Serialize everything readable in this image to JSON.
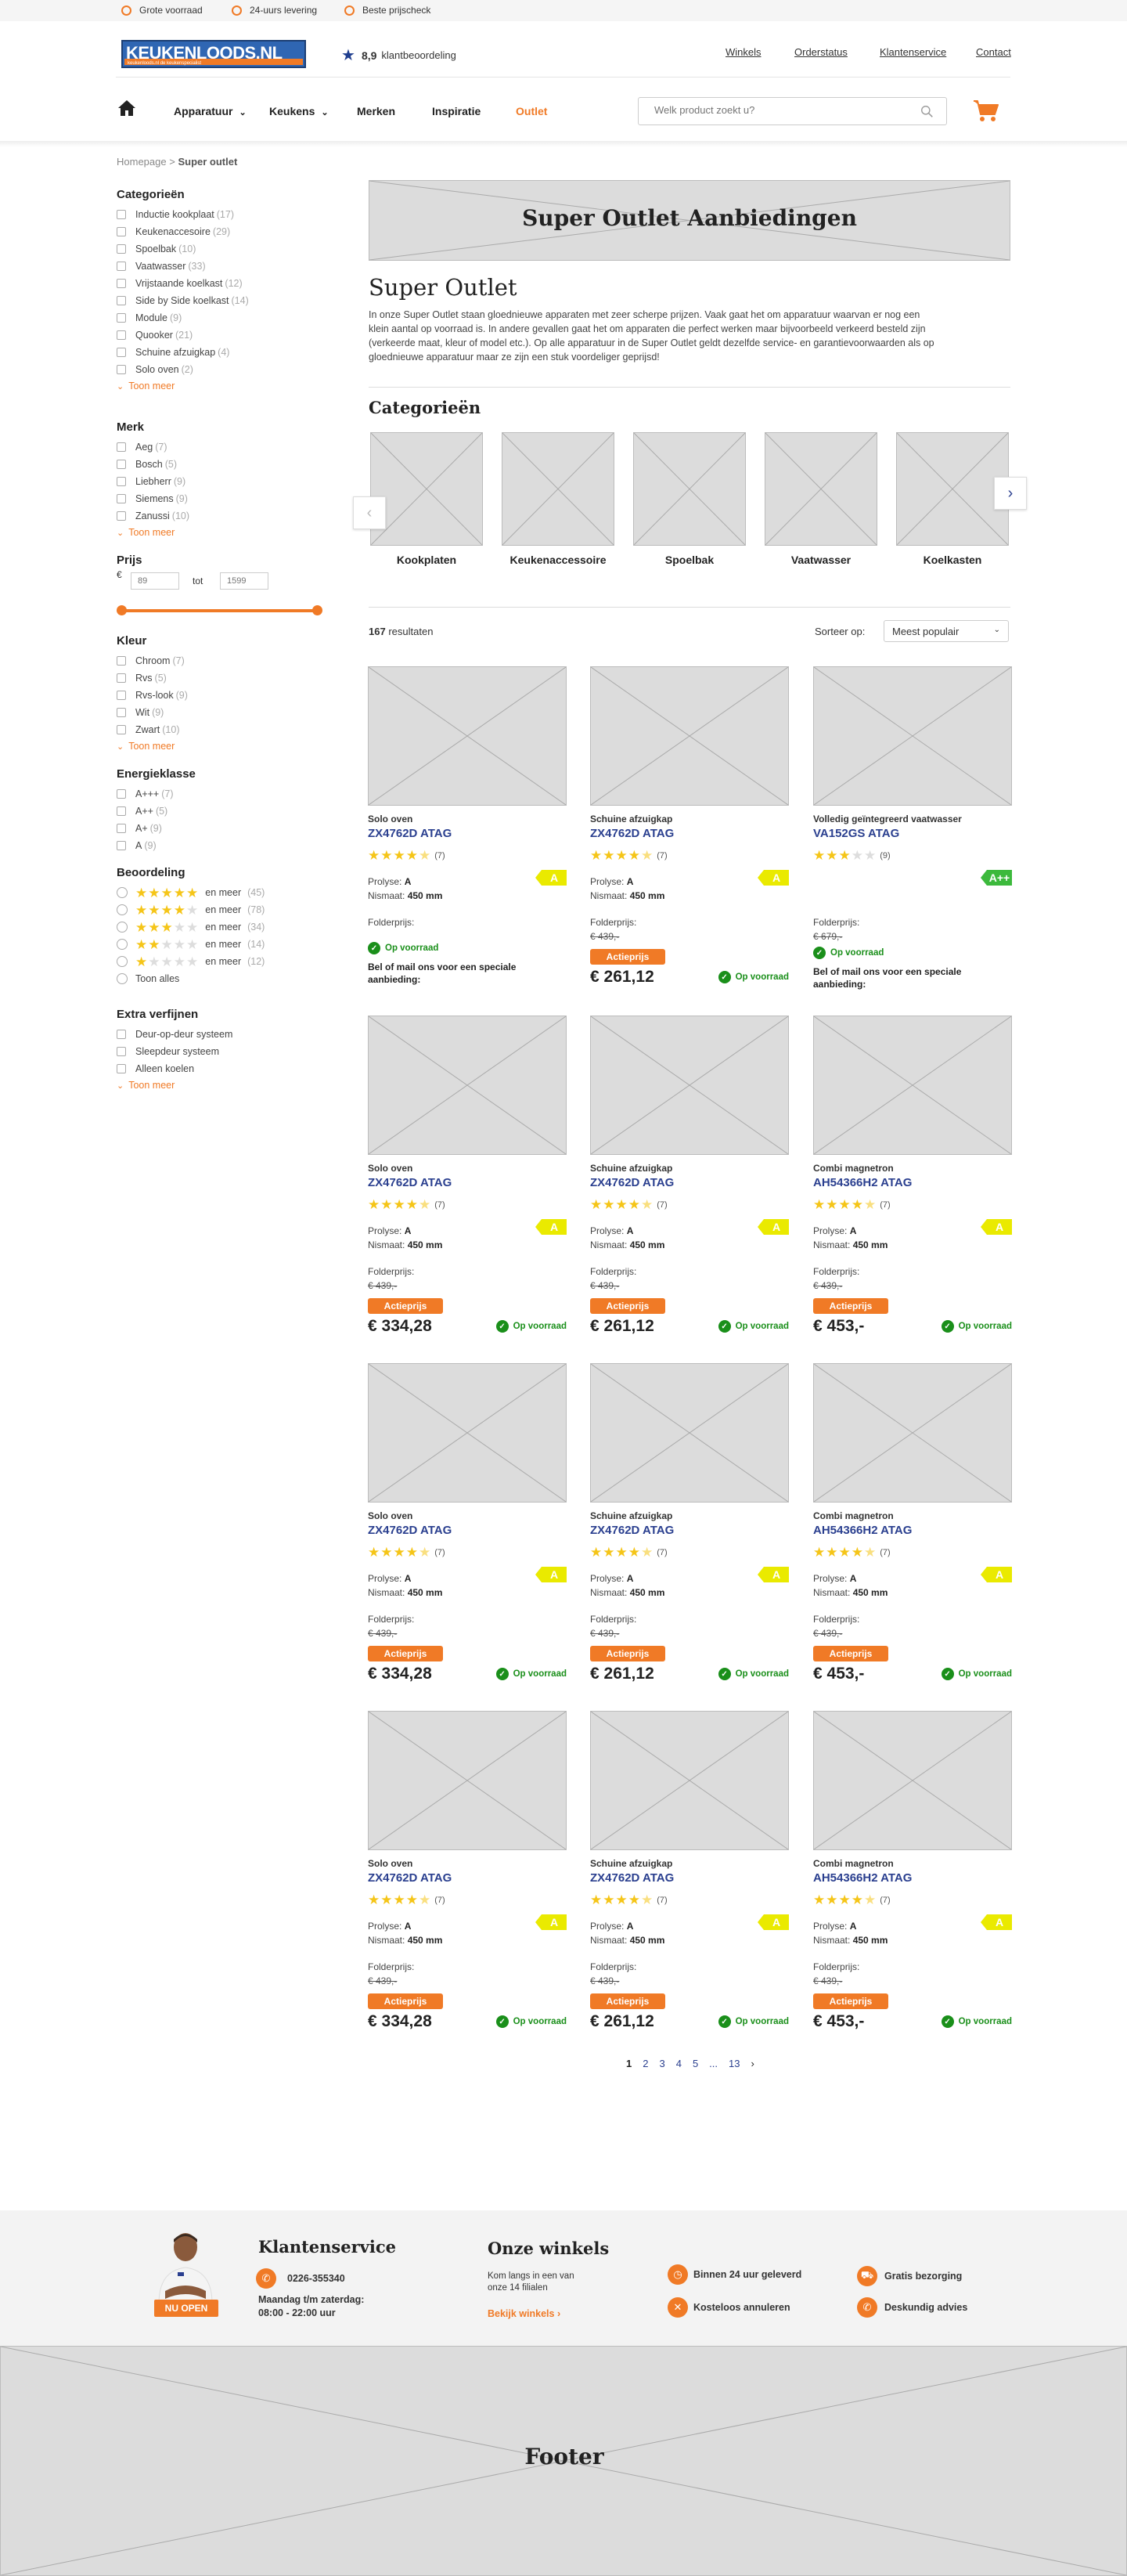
{
  "topbar": {
    "usps": [
      "Grote voorraad",
      "24-uurs levering",
      "Beste prijscheck"
    ]
  },
  "header": {
    "logo_text_a": "KEUKEN",
    "logo_text_b": "LOODS.NL",
    "logo_sub": "keukenloods.nl  de keukenspecialist",
    "rating_value": "8,9",
    "rating_label": "klantbeoordeling",
    "links": [
      "Winkels",
      "Orderstatus",
      "Klantenservice",
      "Contact"
    ]
  },
  "nav": {
    "items": [
      "Apparatuur",
      "Keukens",
      "Merken",
      "Inspiratie",
      "Outlet"
    ],
    "search_placeholder": "Welk product zoekt u?",
    "accent": "#f07a26",
    "brand_blue": "#2a3f8f"
  },
  "breadcrumb": {
    "home": "Homepage",
    "sep": ">",
    "current": "Super outlet"
  },
  "sidebar": {
    "categories": {
      "title": "Categorieën",
      "items": [
        {
          "label": "Inductie kookplaat",
          "count": "(17)"
        },
        {
          "label": "Keukenaccesoire",
          "count": "(29)"
        },
        {
          "label": "Spoelbak",
          "count": "(10)"
        },
        {
          "label": "Vaatwasser",
          "count": "(33)"
        },
        {
          "label": "Vrijstaande koelkast",
          "count": "(12)"
        },
        {
          "label": "Side by Side koelkast",
          "count": "(14)"
        },
        {
          "label": "Module",
          "count": "(9)"
        },
        {
          "label": "Quooker",
          "count": "(21)"
        },
        {
          "label": "Schuine afzuigkap",
          "count": "(4)"
        },
        {
          "label": "Solo oven",
          "count": "(2)"
        }
      ],
      "more": "Toon meer"
    },
    "brands": {
      "title": "Merk",
      "items": [
        {
          "label": "Aeg",
          "count": "(7)"
        },
        {
          "label": "Bosch",
          "count": "(5)"
        },
        {
          "label": "Liebherr",
          "count": "(9)"
        },
        {
          "label": "Siemens",
          "count": "(9)"
        },
        {
          "label": "Zanussi",
          "count": "(10)"
        }
      ],
      "more": "Toon meer"
    },
    "price": {
      "title": "Prijs",
      "currency": "€",
      "min_placeholder": "89",
      "to": "tot",
      "max_placeholder": "1599",
      "slider_low": 0,
      "slider_high": 1
    },
    "colors": {
      "title": "Kleur",
      "items": [
        {
          "label": "Chroom",
          "count": "(7)"
        },
        {
          "label": "Rvs",
          "count": "(5)"
        },
        {
          "label": "Rvs-look",
          "count": "(9)"
        },
        {
          "label": "Wit",
          "count": "(9)"
        },
        {
          "label": "Zwart",
          "count": "(10)"
        }
      ],
      "more": "Toon meer"
    },
    "energy": {
      "title": "Energieklasse",
      "items": [
        {
          "label": "A+++",
          "count": "(7)"
        },
        {
          "label": "A++",
          "count": "(5)"
        },
        {
          "label": "A+",
          "count": "(9)"
        },
        {
          "label": "A",
          "count": "(9)"
        }
      ]
    },
    "reviews": {
      "title": "Beoordeling",
      "items": [
        {
          "stars": 5,
          "label": "en meer",
          "count": "(45)"
        },
        {
          "stars": 4,
          "label": "en meer",
          "count": "(78)"
        },
        {
          "stars": 3,
          "label": "en meer",
          "count": "(34)"
        },
        {
          "stars": 2,
          "label": "en meer",
          "count": "(14)"
        },
        {
          "stars": 1,
          "label": "en meer",
          "count": "(12)"
        }
      ],
      "all": "Toon alles"
    },
    "extra": {
      "title": "Extra verfijnen",
      "items": [
        "Deur-op-deur systeem",
        "Sleepdeur systeem",
        "Alleen koelen"
      ],
      "more": "Toon meer"
    }
  },
  "main": {
    "banner": "Super Outlet Aanbiedingen",
    "title": "Super Outlet",
    "intro": "In onze Super Outlet staan gloednieuwe apparaten met zeer scherpe prijzen. Vaak gaat het om apparatuur waarvan er nog een klein aantal op voorraad is. In andere gevallen gaat het om apparaten die perfect werken maar bijvoorbeeld verkeerd besteld zijn (verkeerde maat, kleur of model etc.). Op alle apparatuur in de Super Outlet geldt dezelfde service- en garantievoorwaarden als op gloednieuwe apparatuur maar ze zijn een stuk voordeliger geprijsd!",
    "categories_title": "Categorieën",
    "categories": [
      "Kookplaten",
      "Keukenaccessoire",
      "Spoelbak",
      "Vaatwasser",
      "Koelkasten"
    ],
    "results_count": "167",
    "results_label": "resultaten",
    "sort_label": "Sorteer op:",
    "sort_value": "Meest populair"
  },
  "products": [
    {
      "cat": "Solo oven",
      "name": "ZX4762D ATAG",
      "stars": 4.5,
      "reviews": "(7)",
      "energy": "A",
      "spec1_label": "Prolyse:",
      "spec1": "A",
      "spec2_label": "Nismaat:",
      "spec2": "450 mm",
      "folder_label": "Folderprijs:",
      "old": "",
      "action": "",
      "price": "",
      "stock": "Op voorraad",
      "mail": "Bel of mail ons voor een speciale aanbieding:"
    },
    {
      "cat": "Schuine afzuigkap",
      "name": "ZX4762D ATAG",
      "stars": 4.5,
      "reviews": "(7)",
      "energy": "A",
      "spec1_label": "Prolyse:",
      "spec1": "A",
      "spec2_label": "Nismaat:",
      "spec2": "450 mm",
      "folder_label": "Folderprijs:",
      "old": "€ 439,-",
      "action": "Actieprijs",
      "price": "€ 261,12",
      "stock": "Op voorraad",
      "mail": ""
    },
    {
      "cat": "Volledig geïntegreerd vaatwasser",
      "name": "VA152GS ATAG",
      "stars": 3,
      "reviews": "(9)",
      "energy": "A++",
      "spec1_label": "",
      "spec1": "",
      "spec2_label": "",
      "spec2": "",
      "folder_label": "Folderprijs:",
      "old": "€ 679,-",
      "action": "",
      "price": "",
      "stock": "Op voorraad",
      "mail": "Bel of mail ons voor een speciale aanbieding:"
    },
    {
      "cat": "Solo oven",
      "name": "ZX4762D ATAG",
      "stars": 4.5,
      "reviews": "(7)",
      "energy": "A",
      "spec1_label": "Prolyse:",
      "spec1": "A",
      "spec2_label": "Nismaat:",
      "spec2": "450 mm",
      "folder_label": "Folderprijs:",
      "old": "€ 439,-",
      "action": "Actieprijs",
      "price": "€ 334,28",
      "stock": "Op voorraad",
      "mail": ""
    },
    {
      "cat": "Schuine afzuigkap",
      "name": "ZX4762D ATAG",
      "stars": 4.5,
      "reviews": "(7)",
      "energy": "A",
      "spec1_label": "Prolyse:",
      "spec1": "A",
      "spec2_label": "Nismaat:",
      "spec2": "450 mm",
      "folder_label": "Folderprijs:",
      "old": "€ 439,-",
      "action": "Actieprijs",
      "price": "€ 261,12",
      "stock": "Op voorraad",
      "mail": ""
    },
    {
      "cat": "Combi magnetron",
      "name": "AH54366H2 ATAG",
      "stars": 4.5,
      "reviews": "(7)",
      "energy": "A",
      "spec1_label": "Prolyse:",
      "spec1": "A",
      "spec2_label": "Nismaat:",
      "spec2": "450 mm",
      "folder_label": "Folderprijs:",
      "old": "€ 439,-",
      "action": "Actieprijs",
      "price": "€ 453,-",
      "stock": "Op voorraad",
      "mail": ""
    },
    {
      "cat": "Solo oven",
      "name": "ZX4762D ATAG",
      "stars": 4.5,
      "reviews": "(7)",
      "energy": "A",
      "spec1_label": "Prolyse:",
      "spec1": "A",
      "spec2_label": "Nismaat:",
      "spec2": "450 mm",
      "folder_label": "Folderprijs:",
      "old": "€ 439,-",
      "action": "Actieprijs",
      "price": "€ 334,28",
      "stock": "Op voorraad",
      "mail": ""
    },
    {
      "cat": "Schuine afzuigkap",
      "name": "ZX4762D ATAG",
      "stars": 4.5,
      "reviews": "(7)",
      "energy": "A",
      "spec1_label": "Prolyse:",
      "spec1": "A",
      "spec2_label": "Nismaat:",
      "spec2": "450 mm",
      "folder_label": "Folderprijs:",
      "old": "€ 439,-",
      "action": "Actieprijs",
      "price": "€ 261,12",
      "stock": "Op voorraad",
      "mail": ""
    },
    {
      "cat": "Combi magnetron",
      "name": "AH54366H2 ATAG",
      "stars": 4.5,
      "reviews": "(7)",
      "energy": "A",
      "spec1_label": "Prolyse:",
      "spec1": "A",
      "spec2_label": "Nismaat:",
      "spec2": "450 mm",
      "folder_label": "Folderprijs:",
      "old": "€ 439,-",
      "action": "Actieprijs",
      "price": "€ 453,-",
      "stock": "Op voorraad",
      "mail": ""
    },
    {
      "cat": "Solo oven",
      "name": "ZX4762D ATAG",
      "stars": 4.5,
      "reviews": "(7)",
      "energy": "A",
      "spec1_label": "Prolyse:",
      "spec1": "A",
      "spec2_label": "Nismaat:",
      "spec2": "450 mm",
      "folder_label": "Folderprijs:",
      "old": "€ 439,-",
      "action": "Actieprijs",
      "price": "€ 334,28",
      "stock": "Op voorraad",
      "mail": ""
    },
    {
      "cat": "Schuine afzuigkap",
      "name": "ZX4762D ATAG",
      "stars": 4.5,
      "reviews": "(7)",
      "energy": "A",
      "spec1_label": "Prolyse:",
      "spec1": "A",
      "spec2_label": "Nismaat:",
      "spec2": "450 mm",
      "folder_label": "Folderprijs:",
      "old": "€ 439,-",
      "action": "Actieprijs",
      "price": "€ 261,12",
      "stock": "Op voorraad",
      "mail": ""
    },
    {
      "cat": "Combi magnetron",
      "name": "AH54366H2 ATAG",
      "stars": 4.5,
      "reviews": "(7)",
      "energy": "A",
      "spec1_label": "Prolyse:",
      "spec1": "A",
      "spec2_label": "Nismaat:",
      "spec2": "450 mm",
      "folder_label": "Folderprijs:",
      "old": "€ 439,-",
      "action": "Actieprijs",
      "price": "€ 453,-",
      "stock": "Op voorraad",
      "mail": ""
    }
  ],
  "pagination": {
    "pages": [
      "1",
      "2",
      "3",
      "4",
      "5",
      "...",
      "13"
    ],
    "next": "›",
    "current": "1"
  },
  "service": {
    "title": "Klantenservice",
    "badge": "NU OPEN",
    "phone": "0226-355340",
    "hours_line1": "Maandag t/m zaterdag:",
    "hours_line2": "08:00 - 22:00 uur",
    "stores_title": "Onze winkels",
    "stores_text_1": "Kom langs in een van",
    "stores_text_2": "onze 14 filialen",
    "stores_link": "Bekijk winkels",
    "usps": [
      "Binnen 24 uur geleverd",
      "Gratis bezorging",
      "Kosteloos annuleren",
      "Deskundig advies"
    ]
  },
  "footer": {
    "label": "Footer"
  }
}
